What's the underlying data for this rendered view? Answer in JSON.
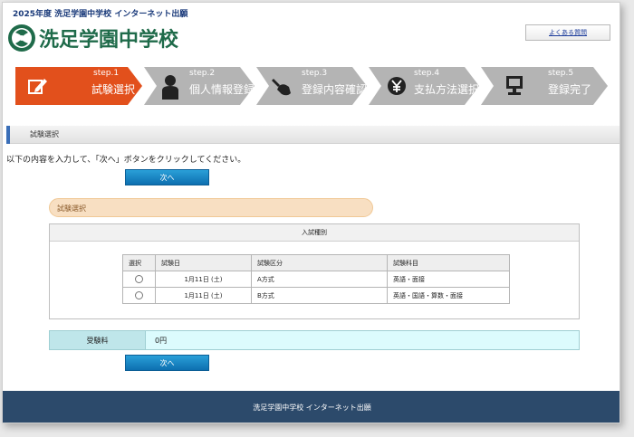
{
  "header": {
    "top_line": "2025年度  洗足学園中学校 インターネット出願",
    "logo_text": "洗足学園中学校",
    "faq_label": "よくある質問"
  },
  "steps": [
    {
      "num": "step.1",
      "label": "試験選択",
      "icon": "pencil-icon",
      "active": true
    },
    {
      "num": "step.2",
      "label": "個人情報登録",
      "icon": "person-icon",
      "active": false
    },
    {
      "num": "step.3",
      "label": "登録内容確認",
      "icon": "hand-stamp-icon",
      "active": false
    },
    {
      "num": "step.4",
      "label": "支払方法選択",
      "icon": "yen-icon",
      "active": false
    },
    {
      "num": "step.5",
      "label": "登録完了",
      "icon": "computer-icon",
      "active": false
    }
  ],
  "section": {
    "title": "試験選択",
    "instruction": "以下の内容を入力して、「次へ」ボタンをクリックしてください。"
  },
  "next_label": "次へ",
  "exam_box": {
    "pill_label": "試験選択",
    "caption": "入試種別",
    "headers": [
      "選択",
      "試験日",
      "試験区分",
      "試験科目"
    ],
    "rows": [
      {
        "date": "1月11日 (土)",
        "type": "A方式",
        "subjects": "英語・面接"
      },
      {
        "date": "1月11日 (土)",
        "type": "B方式",
        "subjects": "英語・国語・算数・面接"
      }
    ]
  },
  "fee": {
    "label": "受験料",
    "value": "0円"
  },
  "footer": {
    "text": "洗足学園中学校 インターネット出願"
  },
  "colors": {
    "active_step": "#e2501c",
    "inactive_step": "#b4b4b4",
    "brand_green": "#1f6b4a",
    "button_blue": "#1585c6"
  }
}
